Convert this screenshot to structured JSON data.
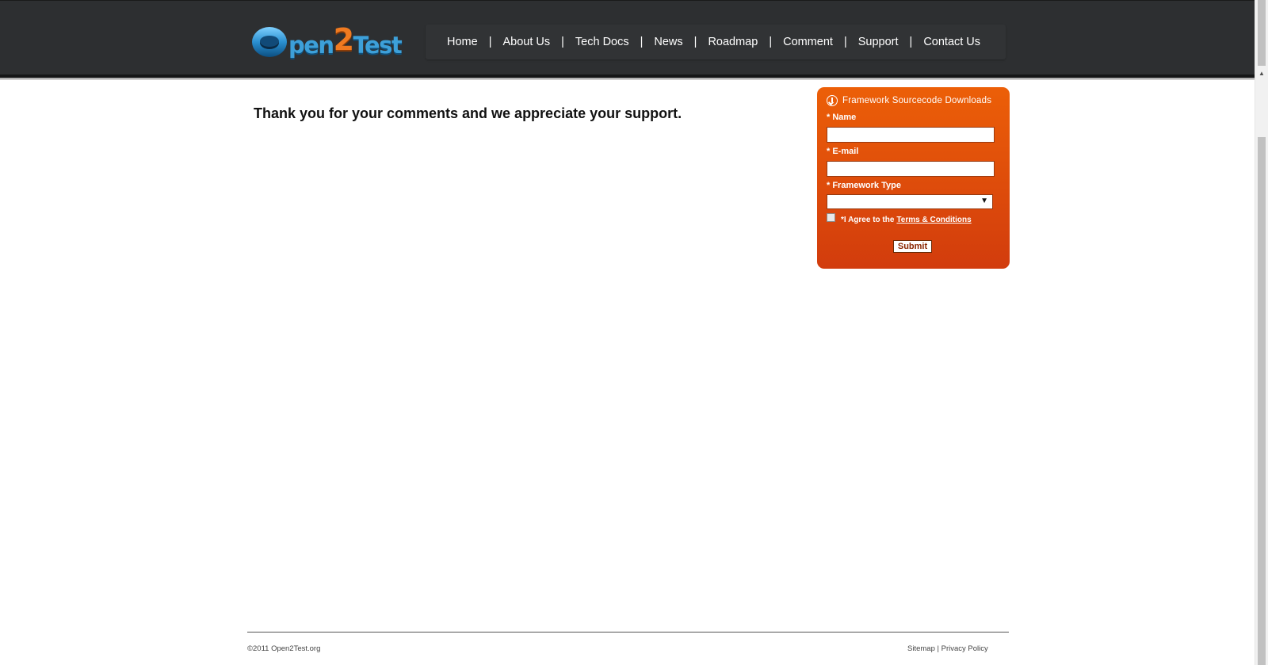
{
  "brand": {
    "logo_prefix": "pen",
    "logo_two": "2",
    "logo_suffix": "Test"
  },
  "nav": {
    "items": [
      "Home",
      "About Us",
      "Tech Docs",
      "News",
      "Roadmap",
      "Comment",
      "Support",
      "Contact Us"
    ],
    "separator": "|"
  },
  "main": {
    "message": "Thank you for your comments and we appreciate your support."
  },
  "download_form": {
    "title": "Framework Sourcecode Downloads",
    "name_label": "* Name",
    "name_value": "",
    "email_label": "* E-mail",
    "email_value": "",
    "framework_label": "* Framework Type",
    "framework_value": "",
    "agree_text": "*I Agree to the",
    "terms_link": "Terms & Conditions",
    "agree_checked": false,
    "submit_label": "Submit"
  },
  "footer": {
    "copyright": "©2011 Open2Test.org",
    "sitemap": "Sitemap",
    "separator": "|",
    "privacy": "Privacy Policy"
  },
  "colors": {
    "header_bg": "#2d2f31",
    "accent_orange": "#ec5f08",
    "logo_blue": "#3da0d9"
  }
}
